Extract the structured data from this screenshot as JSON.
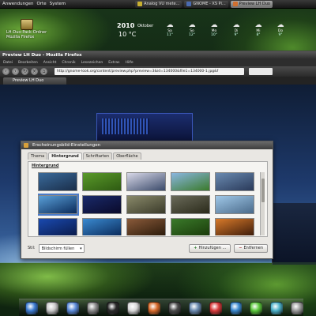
{
  "top_panel": {
    "menu_applications": "Anwendungen",
    "menu_places": "Orte",
    "menu_system": "System",
    "tasks": [
      {
        "label": "Analog VU mete...",
        "icon_color": "#c8b030",
        "active": false
      },
      {
        "label": "GNOME - XS Pi...",
        "icon_color": "#4a6ab0",
        "active": false
      },
      {
        "label": "Preview LH Duo",
        "icon_color": "#d07030",
        "active": true
      }
    ]
  },
  "desktop_icons": [
    {
      "label": "LH-Duo-Pack-Ordner",
      "name": "folder-icon"
    },
    {
      "label": "Mozilla Firefox",
      "name": "folder-icon"
    }
  ],
  "weather": {
    "date": "2010",
    "month": "Oktober",
    "temperature": "10 °C",
    "days": [
      {
        "label": "Sa",
        "temp": "11°"
      },
      {
        "label": "So",
        "temp": "12°"
      },
      {
        "label": "Mo",
        "temp": "10°"
      },
      {
        "label": "Di",
        "temp": "9°"
      },
      {
        "label": "Mi",
        "temp": "8°"
      },
      {
        "label": "Do",
        "temp": "9°"
      }
    ]
  },
  "browser": {
    "title": "Preview LH Duo - Mozilla Firefox",
    "menus": [
      "Datei",
      "Bearbeiten",
      "Ansicht",
      "Chronik",
      "Lesezeichen",
      "Extras",
      "Hilfe"
    ],
    "url": "http://gnome-look.org/content/preview.php?preview=3&id=134000&file1=134000-1.jpg&f",
    "tab_label": "Preview LH Duo"
  },
  "dialog": {
    "title": "Erscheinungsbild-Einstellungen",
    "tabs": [
      "Thema",
      "Hintergrund",
      "Schriftarten",
      "Oberfläche"
    ],
    "active_tab": "Hintergrund",
    "section_label": "Hintergrund",
    "style_label": "Stil:",
    "style_value": "Bildschirm füllen",
    "add_button": "Hinzufügen ...",
    "remove_button": "Entfernen",
    "thumbnails": [
      {
        "color1": "#3a6a9a",
        "color2": "#1a2e4a"
      },
      {
        "color1": "#5a9a2a",
        "color2": "#2e5a12"
      },
      {
        "color1": "#d8d8e8",
        "color2": "#3a4a6a"
      },
      {
        "color1": "#8ab6e0",
        "color2": "#3a7a2a"
      },
      {
        "color1": "#6a8ab0",
        "color2": "#2a3a5a"
      },
      {
        "color1": "#5aa0d8",
        "color2": "#0a2a5a"
      },
      {
        "color1": "#1a2a6a",
        "color2": "#0a0a2a"
      },
      {
        "color1": "#8a8a6a",
        "color2": "#3a3a2a"
      },
      {
        "color1": "#6a6a5a",
        "color2": "#2a2a1a"
      },
      {
        "color1": "#a0c8e8",
        "color2": "#4a6a8a"
      },
      {
        "color1": "#1a4ab0",
        "color2": "#0a1a4a"
      },
      {
        "color1": "#3a8ad0",
        "color2": "#0a2a5a"
      },
      {
        "color1": "#8a5a3a",
        "color2": "#2a1a0a"
      },
      {
        "color1": "#3a7a2a",
        "color2": "#1a3a0a"
      },
      {
        "color1": "#d87a2a",
        "color2": "#3a1a0a"
      }
    ],
    "selected_index": 5
  },
  "dock": {
    "items": [
      {
        "name": "home-icon",
        "color": "#3a7ad0"
      },
      {
        "name": "home-icon",
        "color": "#c8c8c8"
      },
      {
        "name": "document-icon",
        "color": "#5a8ad8"
      },
      {
        "name": "folder-icon",
        "color": "#8a8a8a"
      },
      {
        "name": "terminal-icon",
        "color": "#2a2a2a"
      },
      {
        "name": "image-viewer-icon",
        "color": "#d8d8d8"
      },
      {
        "name": "firefox-icon",
        "color": "#d86a2a"
      },
      {
        "name": "media-player-icon",
        "color": "#4a4a4a"
      },
      {
        "name": "settings-icon",
        "color": "#6a8ab0"
      },
      {
        "name": "calendar-icon",
        "color": "#d83a3a"
      },
      {
        "name": "help-icon",
        "color": "#3a8ad0"
      },
      {
        "name": "chat-icon",
        "color": "#5ac83a"
      },
      {
        "name": "music-icon",
        "color": "#4ab0c8"
      },
      {
        "name": "trash-icon",
        "color": "#9a9a9a"
      }
    ]
  }
}
